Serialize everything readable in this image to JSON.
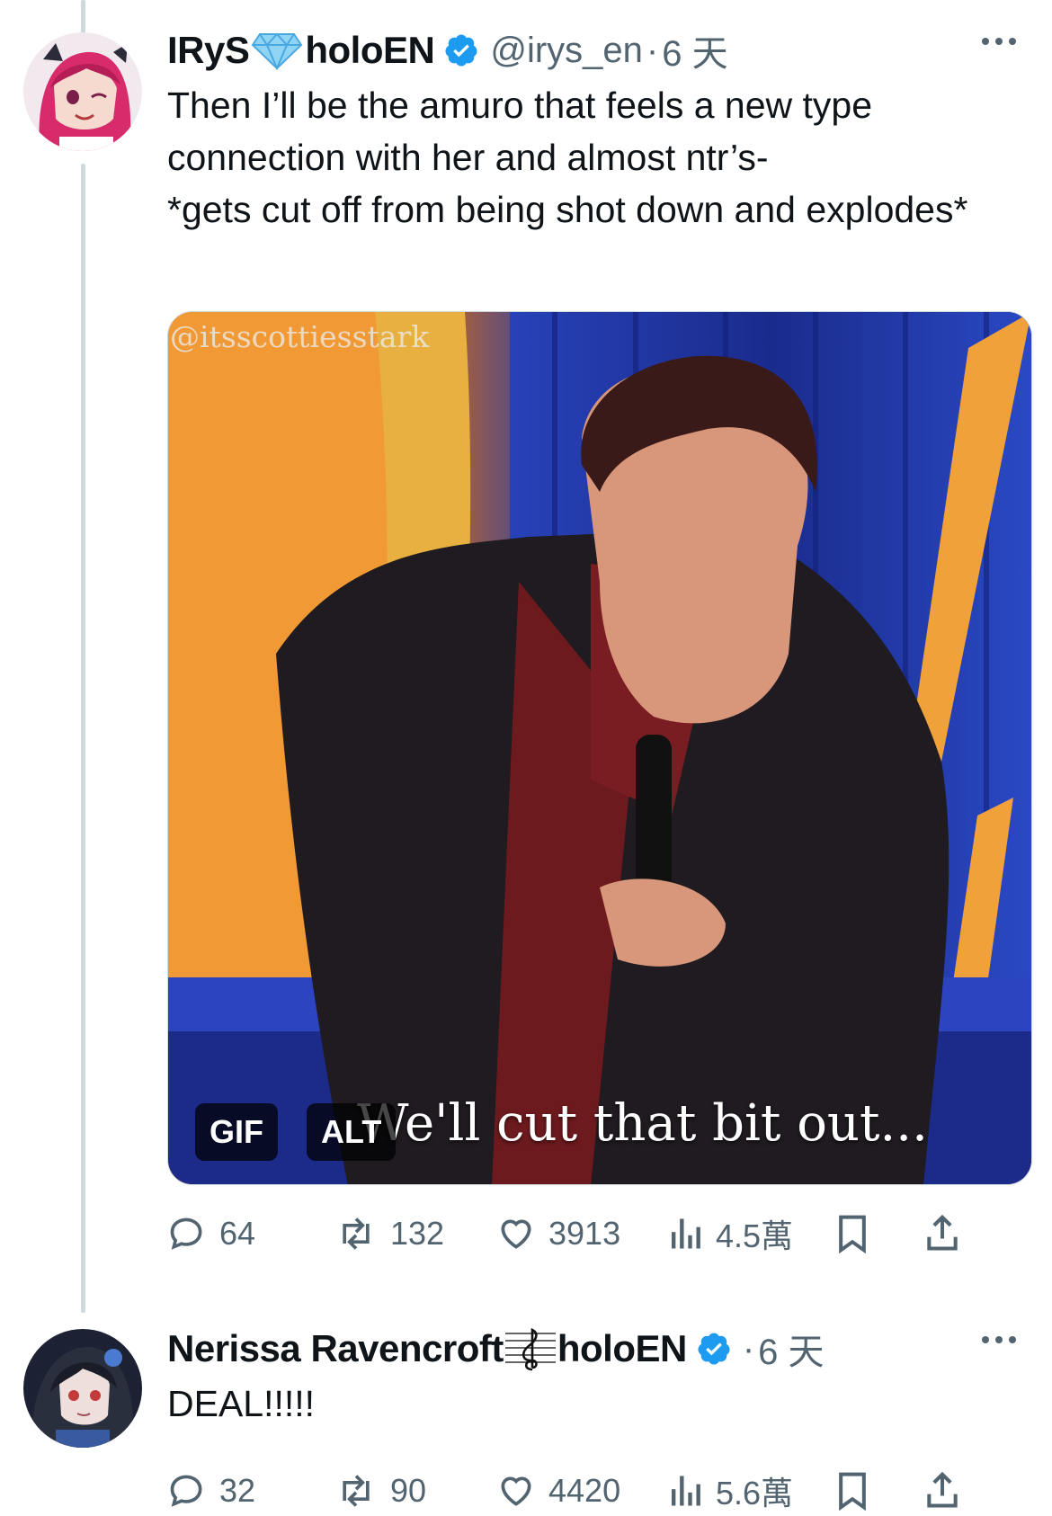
{
  "tweets": [
    {
      "display_name_part1": "IRyS",
      "emoji_icon": "gem-icon",
      "display_name_part2": "holoEN",
      "handle": "@irys_en",
      "separator": "·",
      "time": "6 天",
      "text": "Then I’ll be the amuro that feels a new type connection with her and almost ntr’s-\n *gets cut off from being shot down and explodes*",
      "media": {
        "watermark": "@itsscottiesstark",
        "gif_badge": "GIF",
        "alt_badge": "ALT",
        "caption": "We'll cut that bit out..."
      },
      "stats": {
        "replies": "64",
        "reposts": "132",
        "likes": "3913",
        "views": "4.5萬"
      }
    },
    {
      "display_name_part1": "Nerissa Ravencroft",
      "emoji_icon": "musical-score-icon",
      "display_name_part2": "holoEN",
      "separator": "·",
      "time": "6 天",
      "text": "DEAL!!!!!",
      "stats": {
        "replies": "32",
        "reposts": "90",
        "likes": "4420",
        "views": "5.6萬"
      }
    }
  ],
  "colors": {
    "verified": "#1d9bf0",
    "secondary_text": "#536471",
    "thread_line": "#cfd9de"
  }
}
